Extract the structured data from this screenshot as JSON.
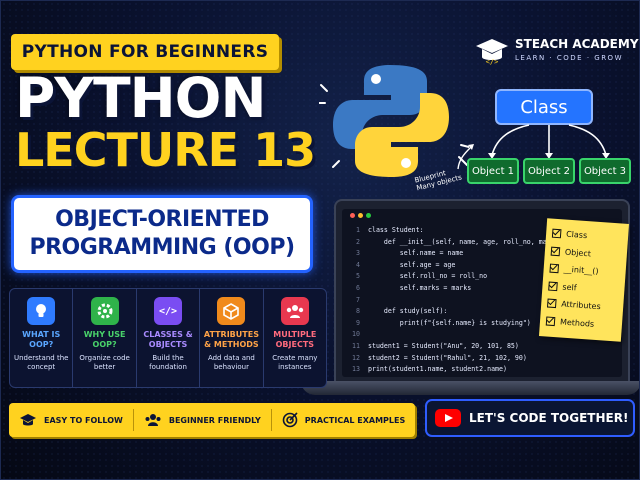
{
  "header": {
    "series_tag": "PYTHON FOR BEGINNERS",
    "title": "PYTHON",
    "lecture": "LECTURE 13"
  },
  "topic": {
    "line1": "OBJECT-ORIENTED",
    "line2": "PROGRAMMING (OOP)"
  },
  "brand": {
    "name": "STEACH ACADEMY",
    "tagline": "LEARN · CODE · GROW"
  },
  "diagram": {
    "class_label": "Class",
    "objects": [
      "Object 1",
      "Object 2",
      "Object 3"
    ],
    "annotation_line1": "Blueprint",
    "annotation_line2": "Many objects"
  },
  "topics": [
    {
      "title": "WHAT IS OOP?",
      "desc": "Understand the concept",
      "color": "#2f7bff",
      "icon": "lightbulb-icon"
    },
    {
      "title": "WHY USE OOP?",
      "desc": "Organize code better",
      "color": "#2fb34a",
      "icon": "gear-icon"
    },
    {
      "title": "CLASSES & OBJECTS",
      "desc": "Build the foundation",
      "color": "#7a4df2",
      "icon": "code-icon"
    },
    {
      "title": "ATTRIBUTES & METHODS",
      "desc": "Add data and behaviour",
      "color": "#f08a1c",
      "icon": "cube-icon"
    },
    {
      "title": "MULTIPLE OBJECTS",
      "desc": "Create many instances",
      "color": "#e8384f",
      "icon": "users-icon"
    }
  ],
  "code": [
    {
      "n": "1",
      "t": "class Student:"
    },
    {
      "n": "2",
      "t": "    def __init__(self, name, age, roll_no, marks):"
    },
    {
      "n": "3",
      "t": "        self.name = name"
    },
    {
      "n": "4",
      "t": "        self.age = age"
    },
    {
      "n": "5",
      "t": "        self.roll_no = roll_no"
    },
    {
      "n": "6",
      "t": "        self.marks = marks"
    },
    {
      "n": "7",
      "t": ""
    },
    {
      "n": "8",
      "t": "    def study(self):"
    },
    {
      "n": "9",
      "t": "        print(f\"{self.name} is studying\")"
    },
    {
      "n": "10",
      "t": ""
    },
    {
      "n": "11",
      "t": "student1 = Student(\"Anu\", 20, 101, 85)"
    },
    {
      "n": "12",
      "t": "student2 = Student(\"Rahul\", 21, 102, 90)"
    },
    {
      "n": "13",
      "t": "print(student1.name, student2.name)"
    }
  ],
  "checklist": [
    "Class",
    "Object",
    "__init__()",
    "self",
    "Attributes",
    "Methods"
  ],
  "features": [
    "EASY TO FOLLOW",
    "BEGINNER FRIENDLY",
    "PRACTICAL EXAMPLES"
  ],
  "cta": "LET'S CODE TOGETHER!"
}
